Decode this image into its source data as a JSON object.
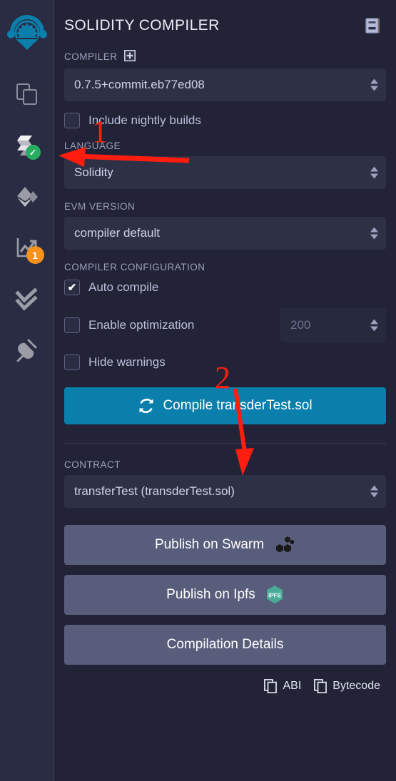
{
  "app": {
    "background_color": "#222336",
    "accent_color": "#0b7fac",
    "panel_color": "#2e3145"
  },
  "iconbar": {
    "logo": {
      "name": "remix-logo",
      "color": "#0b7fac"
    },
    "items": [
      {
        "name": "file-explorers-icon",
        "label": "File explorers",
        "badge": null
      },
      {
        "name": "solidity-compiler-icon",
        "label": "Solidity compiler",
        "badge": "✔",
        "badge_type": "check",
        "badge_color": "#27ae60",
        "active": true
      },
      {
        "name": "deploy-run-transactions-icon",
        "label": "Deploy & run transactions",
        "badge": null
      },
      {
        "name": "solidity-static-analysis-icon",
        "label": "Solidity static analysis",
        "badge": "1",
        "badge_type": "count",
        "badge_color": "#f5921e"
      },
      {
        "name": "solidity-unit-testing-icon",
        "label": "Solidity unit testing",
        "badge": null
      },
      {
        "name": "plugin-manager-icon",
        "label": "Plugin manager",
        "badge": null
      }
    ]
  },
  "header": {
    "title": "SOLIDITY COMPILER",
    "doc_icon": "book-icon"
  },
  "compiler": {
    "label": "COMPILER",
    "add_icon": "plus-box-icon",
    "version": "0.7.5+commit.eb77ed08",
    "nightly": {
      "label": "Include nightly builds",
      "checked": false
    }
  },
  "language": {
    "label": "LANGUAGE",
    "value": "Solidity"
  },
  "evm": {
    "label": "EVM VERSION",
    "value": "compiler default"
  },
  "configuration": {
    "label": "COMPILER CONFIGURATION",
    "auto_compile": {
      "label": "Auto compile",
      "checked": true
    },
    "enable_optimization": {
      "label": "Enable optimization",
      "checked": false
    },
    "hide_warnings": {
      "label": "Hide warnings",
      "checked": false
    },
    "runs": {
      "value": "200",
      "placeholder": "200"
    }
  },
  "compile_button": {
    "label": "Compile transderTest.sol",
    "icon": "refresh-icon"
  },
  "contract": {
    "label": "CONTRACT",
    "value": "transferTest (transderTest.sol)"
  },
  "actions": {
    "publish_swarm": {
      "label": "Publish on Swarm",
      "icon": "swarm-icon"
    },
    "publish_ipfs": {
      "label": "Publish on Ipfs",
      "icon": "ipfs-icon",
      "icon_text": "IPFS"
    },
    "compilation_details": {
      "label": "Compilation Details"
    }
  },
  "copy_row": {
    "abi": {
      "label": "ABI",
      "icon": "copy-icon"
    },
    "bytecode": {
      "label": "Bytecode",
      "icon": "copy-icon"
    }
  },
  "annotations": {
    "color": "#ff1d10",
    "marker_1": {
      "label": "1",
      "points_to": "solidity-compiler-icon"
    },
    "marker_2": {
      "label": "2",
      "points_to": "compile-button"
    }
  }
}
